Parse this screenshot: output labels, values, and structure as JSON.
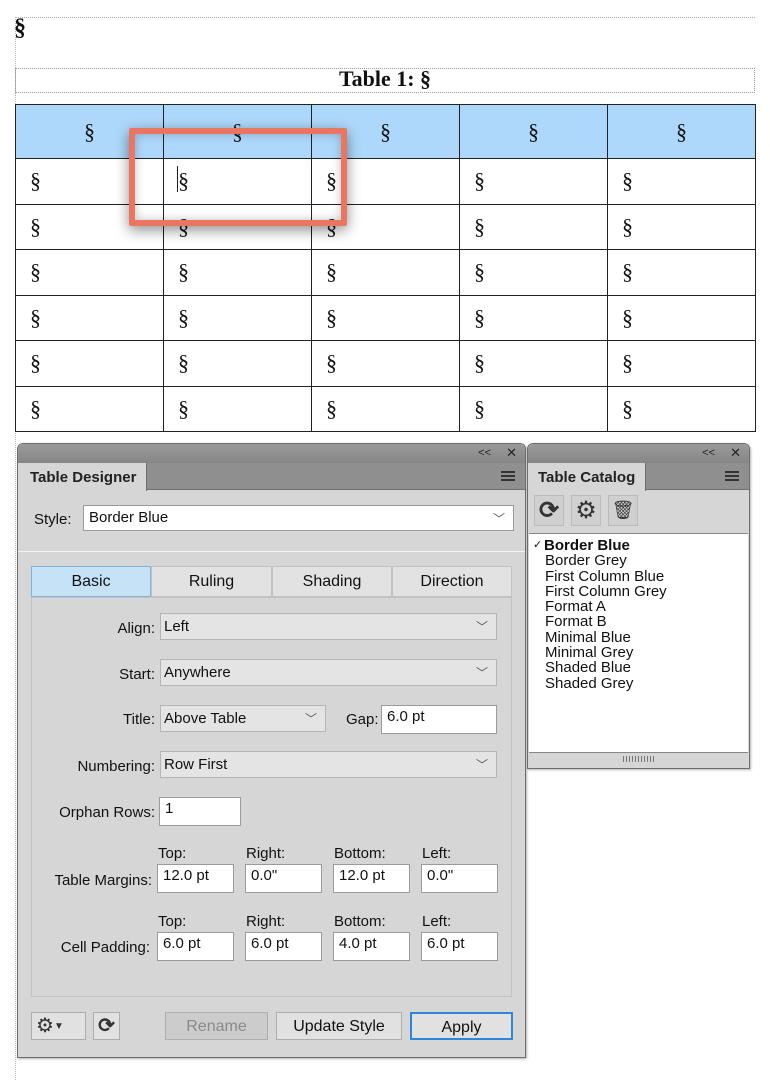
{
  "document": {
    "paragraph_mark": "§",
    "caption": "Table 1: §",
    "table": {
      "header": [
        "§",
        "§",
        "§",
        "§",
        "§"
      ],
      "rows": [
        [
          "§",
          "§",
          "§",
          "§",
          "§"
        ],
        [
          "§",
          "§",
          "§",
          "§",
          "§"
        ],
        [
          "§",
          "§",
          "§",
          "§",
          "§"
        ],
        [
          "§",
          "§",
          "§",
          "§",
          "§"
        ],
        [
          "§",
          "§",
          "§",
          "§",
          "§"
        ],
        [
          "§",
          "§",
          "§",
          "§",
          "§"
        ]
      ],
      "header_color": "#aed8fb"
    }
  },
  "designer": {
    "title": "Table Designer",
    "collapse_icon": "<<",
    "close_icon": "✕",
    "style_label": "Style:",
    "style_value": "Border Blue",
    "tabs": [
      "Basic",
      "Ruling",
      "Shading",
      "Direction"
    ],
    "align_label": "Align:",
    "align_value": "Left",
    "start_label": "Start:",
    "start_value": "Anywhere",
    "title_label": "Title:",
    "title_value": "Above Table",
    "gap_label": "Gap:",
    "gap_value": "6.0 pt",
    "numbering_label": "Numbering:",
    "numbering_value": "Row First",
    "orphan_label": "Orphan Rows:",
    "orphan_value": "1",
    "col_labels": [
      "Top:",
      "Right:",
      "Bottom:",
      "Left:"
    ],
    "margins_label": "Table Margins:",
    "margins": [
      "12.0 pt",
      "0.0\"",
      "12.0 pt",
      "0.0\""
    ],
    "padding_label": "Cell Padding:",
    "padding": [
      "6.0 pt",
      "6.0 pt",
      "4.0 pt",
      "6.0 pt"
    ],
    "rename": "Rename",
    "update_style": "Update Style",
    "apply": "Apply"
  },
  "catalog": {
    "title": "Table Catalog",
    "collapse_icon": "<<",
    "close_icon": "✕",
    "check": "✓",
    "items": [
      "Border Blue",
      "Border Grey",
      "First Column Blue",
      "First Column Grey",
      "Format A",
      "Format B",
      "Minimal Blue",
      "Minimal Grey",
      "Shaded Blue",
      "Shaded Grey"
    ],
    "selected": "Border Blue"
  }
}
